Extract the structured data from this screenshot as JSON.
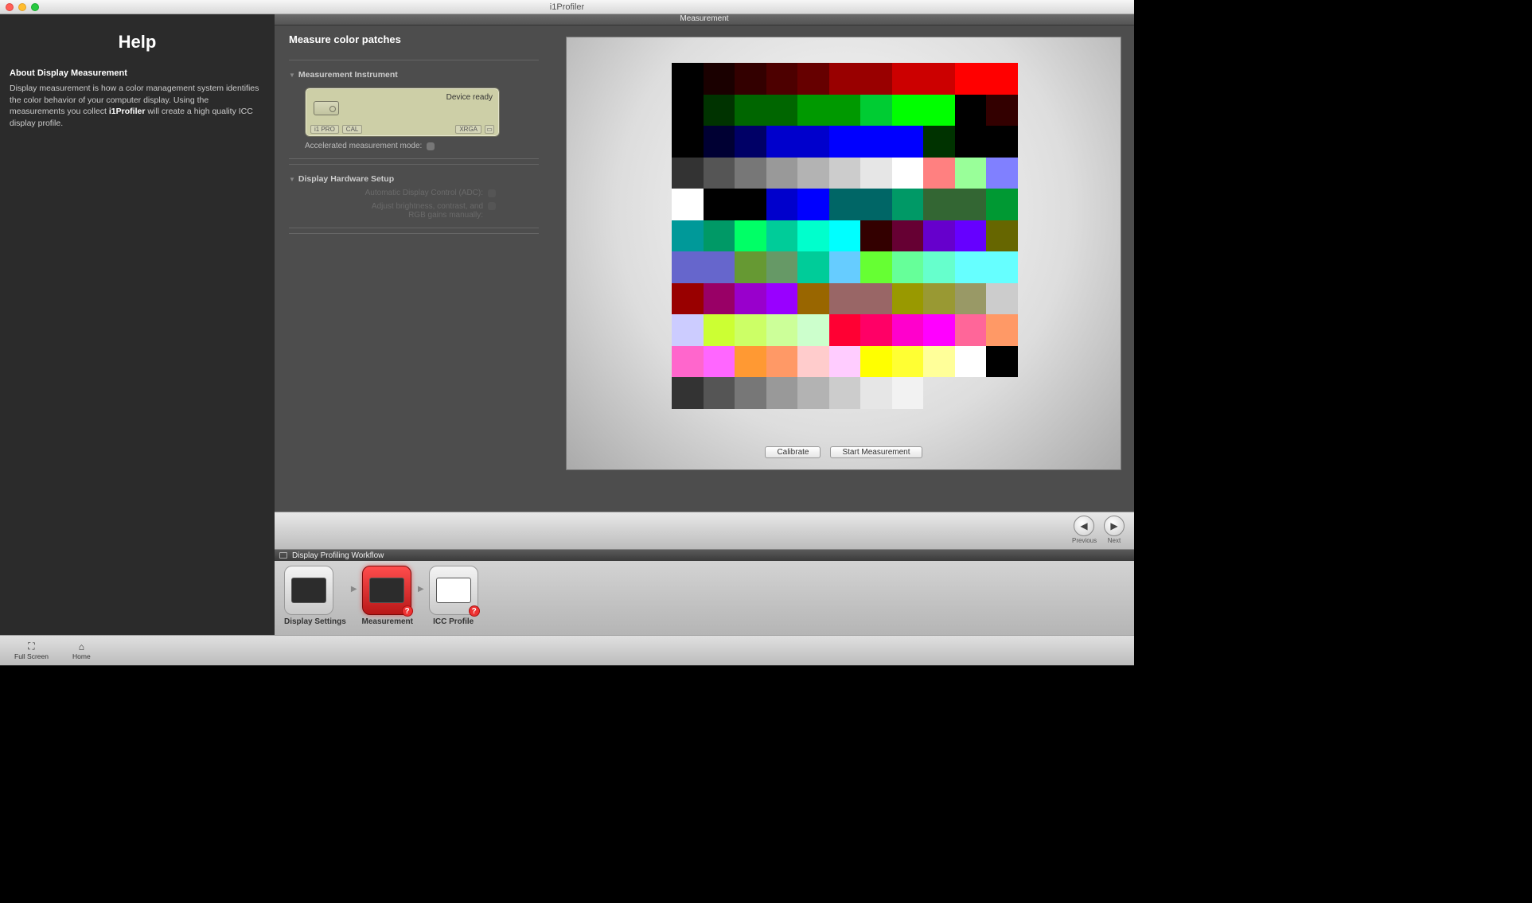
{
  "titlebar": {
    "title": "i1Profiler"
  },
  "help": {
    "title": "Help",
    "subtitle": "About Display Measurement",
    "text_a": "Display measurement is how a color management system identifies the color behavior of your computer display. Using the measurements you collect ",
    "text_bold": "i1Profiler",
    "text_b": " will create a high quality ICC display profile."
  },
  "section_header": "Measurement",
  "settings": {
    "title": "Measure color patches",
    "instrument_header": "Measurement Instrument",
    "device_status": "Device ready",
    "tag_i1pro": "i1 PRO",
    "tag_cal": "CAL",
    "tag_xrga": "XRGA",
    "accel_label": "Accelerated measurement mode:",
    "hardware_header": "Display Hardware Setup",
    "adc_label": "Automatic Display Control (ADC):",
    "manual_label_a": "Adjust brightness, contrast, and",
    "manual_label_b": "RGB gains manually:"
  },
  "buttons": {
    "calibrate": "Calibrate",
    "start": "Start Measurement"
  },
  "nav": {
    "previous": "Previous",
    "next": "Next"
  },
  "workflow": {
    "title": "Display Profiling Workflow",
    "step1": "Display Settings",
    "step2": "Measurement",
    "step3": "ICC Profile"
  },
  "bottom": {
    "fullscreen": "Full Screen",
    "home": "Home"
  },
  "chart_data": {
    "type": "heatmap",
    "title": "Color measurement patches",
    "grid_cols": 11,
    "rows": [
      [
        "#000000",
        "#1a0000",
        "#330000",
        "#4d0000",
        "#660000",
        "#990000",
        "#990000",
        "#cc0000",
        "#cc0000",
        "#ff0000",
        "#ff0000"
      ],
      [
        "#000000",
        "#003300",
        "#006600",
        "#006600",
        "#009900",
        "#009900",
        "#00cc33",
        "#00ff00",
        "#00ff00",
        "#000000",
        "#330000"
      ],
      [
        "#000000",
        "#000033",
        "#000066",
        "#0000cc",
        "#0000cc",
        "#0000ff",
        "#0000ff",
        "#0000ff",
        "#003300",
        "#000000",
        "#000000"
      ],
      [
        "#333333",
        "#555555",
        "#777777",
        "#999999",
        "#b3b3b3",
        "#cccccc",
        "#e6e6e6",
        "#ffffff",
        "#ff8080",
        "#99ff99",
        "#8080ff"
      ],
      [
        "#ffffff",
        "#000000",
        "#000000",
        "#0000cc",
        "#0000ff",
        "#006666",
        "#006666",
        "#009966",
        "#336633",
        "#336633",
        "#009933"
      ],
      [
        "#009999",
        "#009966",
        "#00ff66",
        "#00cc99",
        "#00ffcc",
        "#00ffff",
        "#330000",
        "#660033",
        "#6600cc",
        "#6600ff",
        "#666600"
      ],
      [
        "#6666cc",
        "#6666cc",
        "#669933",
        "#669966",
        "#00cc99",
        "#66ccff",
        "#66ff33",
        "#66ff99",
        "#66ffcc",
        "#66ffff",
        "#66ffff"
      ],
      [
        "#990000",
        "#990066",
        "#9900cc",
        "#9900ff",
        "#996600",
        "#996666",
        "#996666",
        "#999900",
        "#999933",
        "#999966",
        "#cccccc"
      ],
      [
        "#ccccff",
        "#ccff33",
        "#ccff66",
        "#ccff99",
        "#ccffcc",
        "#ff0033",
        "#ff0066",
        "#ff00cc",
        "#ff00ff",
        "#ff6699",
        "#ff9966"
      ],
      [
        "#ff66cc",
        "#ff66ff",
        "#ff9933",
        "#ff9966",
        "#ffcccc",
        "#ffccff",
        "#ffff00",
        "#ffff33",
        "#ffff99",
        "#ffffff",
        "#000000"
      ],
      [
        "#333333",
        "#555555",
        "#777777",
        "#999999",
        "#b3b3b3",
        "#cccccc",
        "#e6e6e6",
        "#f2f2f2"
      ]
    ]
  }
}
